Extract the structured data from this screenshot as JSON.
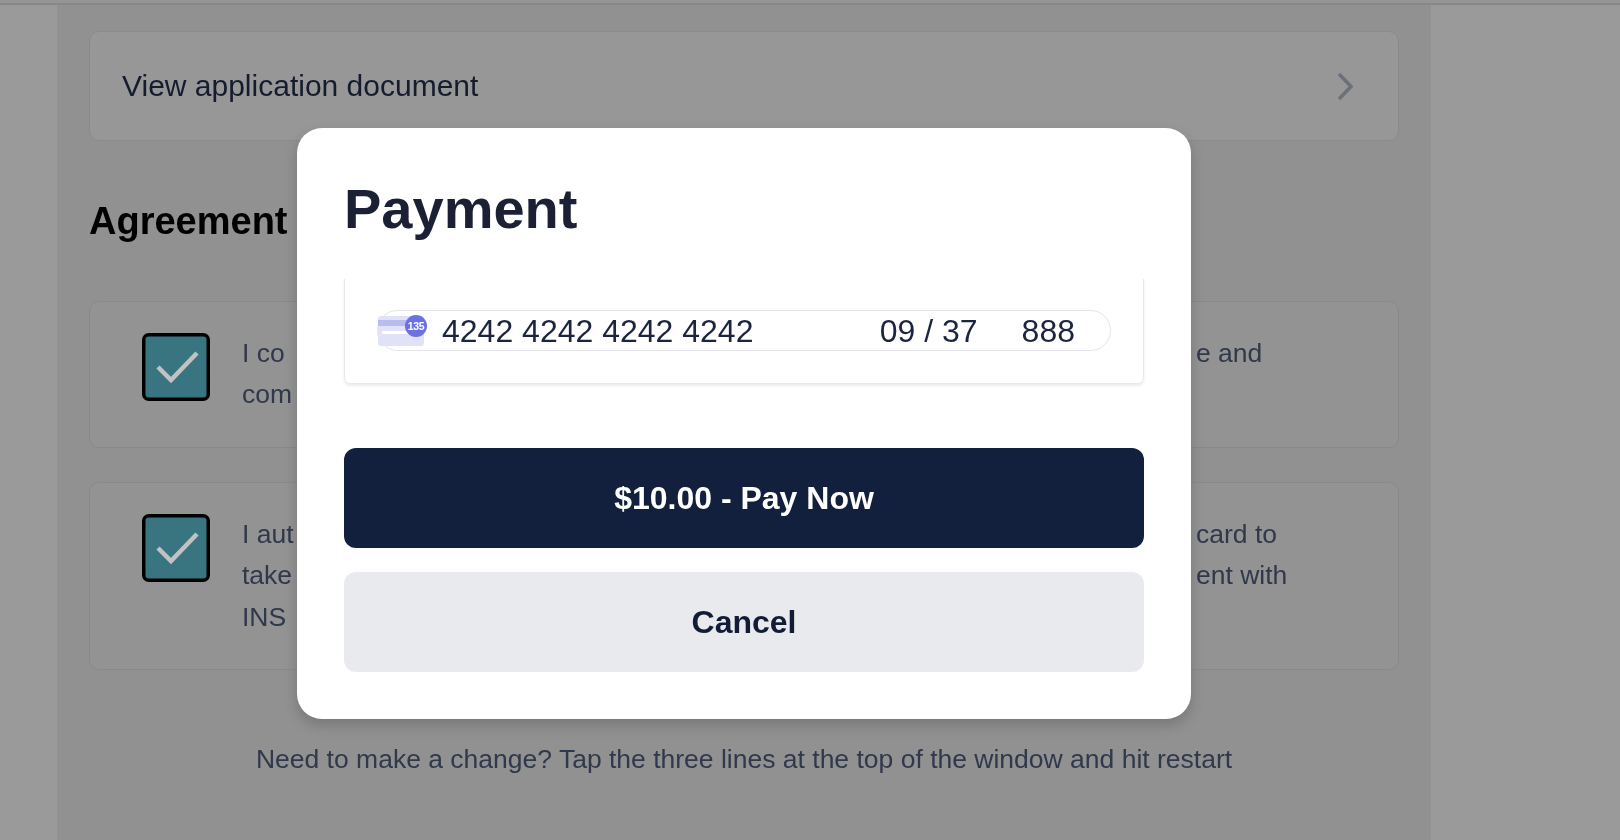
{
  "document_link": {
    "label": "View application document"
  },
  "agreement": {
    "heading": "Agreement",
    "items": [
      {
        "checked": true,
        "text_left": [
          "I co",
          "com"
        ],
        "text_right": [
          "e and"
        ]
      },
      {
        "checked": true,
        "text_left": [
          "I aut",
          "take",
          "INS"
        ],
        "text_right": [
          "card to",
          "ent with"
        ]
      }
    ]
  },
  "footer_hint": "Need to make a change? Tap the three lines at the top of the window and hit restart",
  "payment_dialog": {
    "title": "Payment",
    "card_input": {
      "badge": "135",
      "number": "4242 4242 4242 4242",
      "expiry": "09 / 37",
      "cvc": "888"
    },
    "buttons": [
      {
        "kind": "primary",
        "label": "$10.00 - Pay Now"
      },
      {
        "kind": "secondary",
        "label": "Cancel"
      }
    ]
  }
}
